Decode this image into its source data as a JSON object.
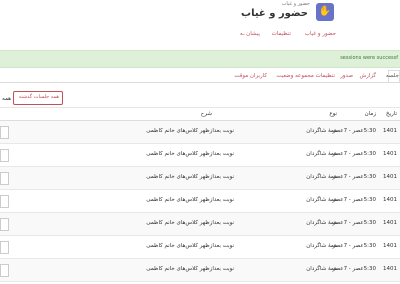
{
  "header": {
    "app_subtitle": "حضور و غیاب",
    "app_title": "حضور و غیاب",
    "logo_icon": "hand-icon"
  },
  "nav": {
    "items": [
      "حضور و غیاب",
      "تنظیمات",
      "پیشان ـه"
    ]
  },
  "alert": {
    "text": "sessions were successf"
  },
  "tabs": {
    "items": [
      "جلسه",
      "گزارش",
      "صدور",
      "تنظیمات مجموعه وضعیت",
      "کاربران موقت"
    ]
  },
  "filter": {
    "label": "همه",
    "pill_label": "همه جلسات گذشته"
  },
  "table": {
    "headers": {
      "date": "تاریخ",
      "time": "زمان",
      "type": "نوع",
      "description": "شرح"
    },
    "rows": [
      {
        "date": "1401",
        "time": "5:30عصر - 7عصر",
        "type": "همهٔ شاگردان",
        "description": "نوبت بعدازظهر کلاس‌های خانم کاظمی"
      },
      {
        "date": "1401",
        "time": "5:30عصر - 7عصر",
        "type": "همهٔ شاگردان",
        "description": "نوبت بعدازظهر کلاس‌های خانم کاظمی"
      },
      {
        "date": "1401",
        "time": "5:30عصر - 7عصر",
        "type": "همهٔ شاگردان",
        "description": "نوبت بعدازظهر کلاس‌های خانم کاظمی"
      },
      {
        "date": "1401",
        "time": "5:30عصر - 7عصر",
        "type": "همهٔ شاگردان",
        "description": "نوبت بعدازظهر کلاس‌های خانم کاظمی"
      },
      {
        "date": "1401",
        "time": "5:30عصر - 7عصر",
        "type": "همهٔ شاگردان",
        "description": "نوبت بعدازظهر کلاس‌های خانم کاظمی"
      },
      {
        "date": "1401",
        "time": "5:30عصر - 7عصر",
        "type": "همهٔ شاگردان",
        "description": "نوبت بعدازظهر کلاس‌های خانم کاظمی"
      },
      {
        "date": "1401",
        "time": "5:30عصر - 7عصر",
        "type": "همهٔ شاگردان",
        "description": "نوبت بعدازظهر کلاس‌های خانم کاظمی"
      }
    ]
  },
  "colors": {
    "accent": "#c0505a",
    "logo_bg": "#6673c9",
    "alert_bg": "#dff0d8",
    "alert_text": "#3c763d"
  }
}
